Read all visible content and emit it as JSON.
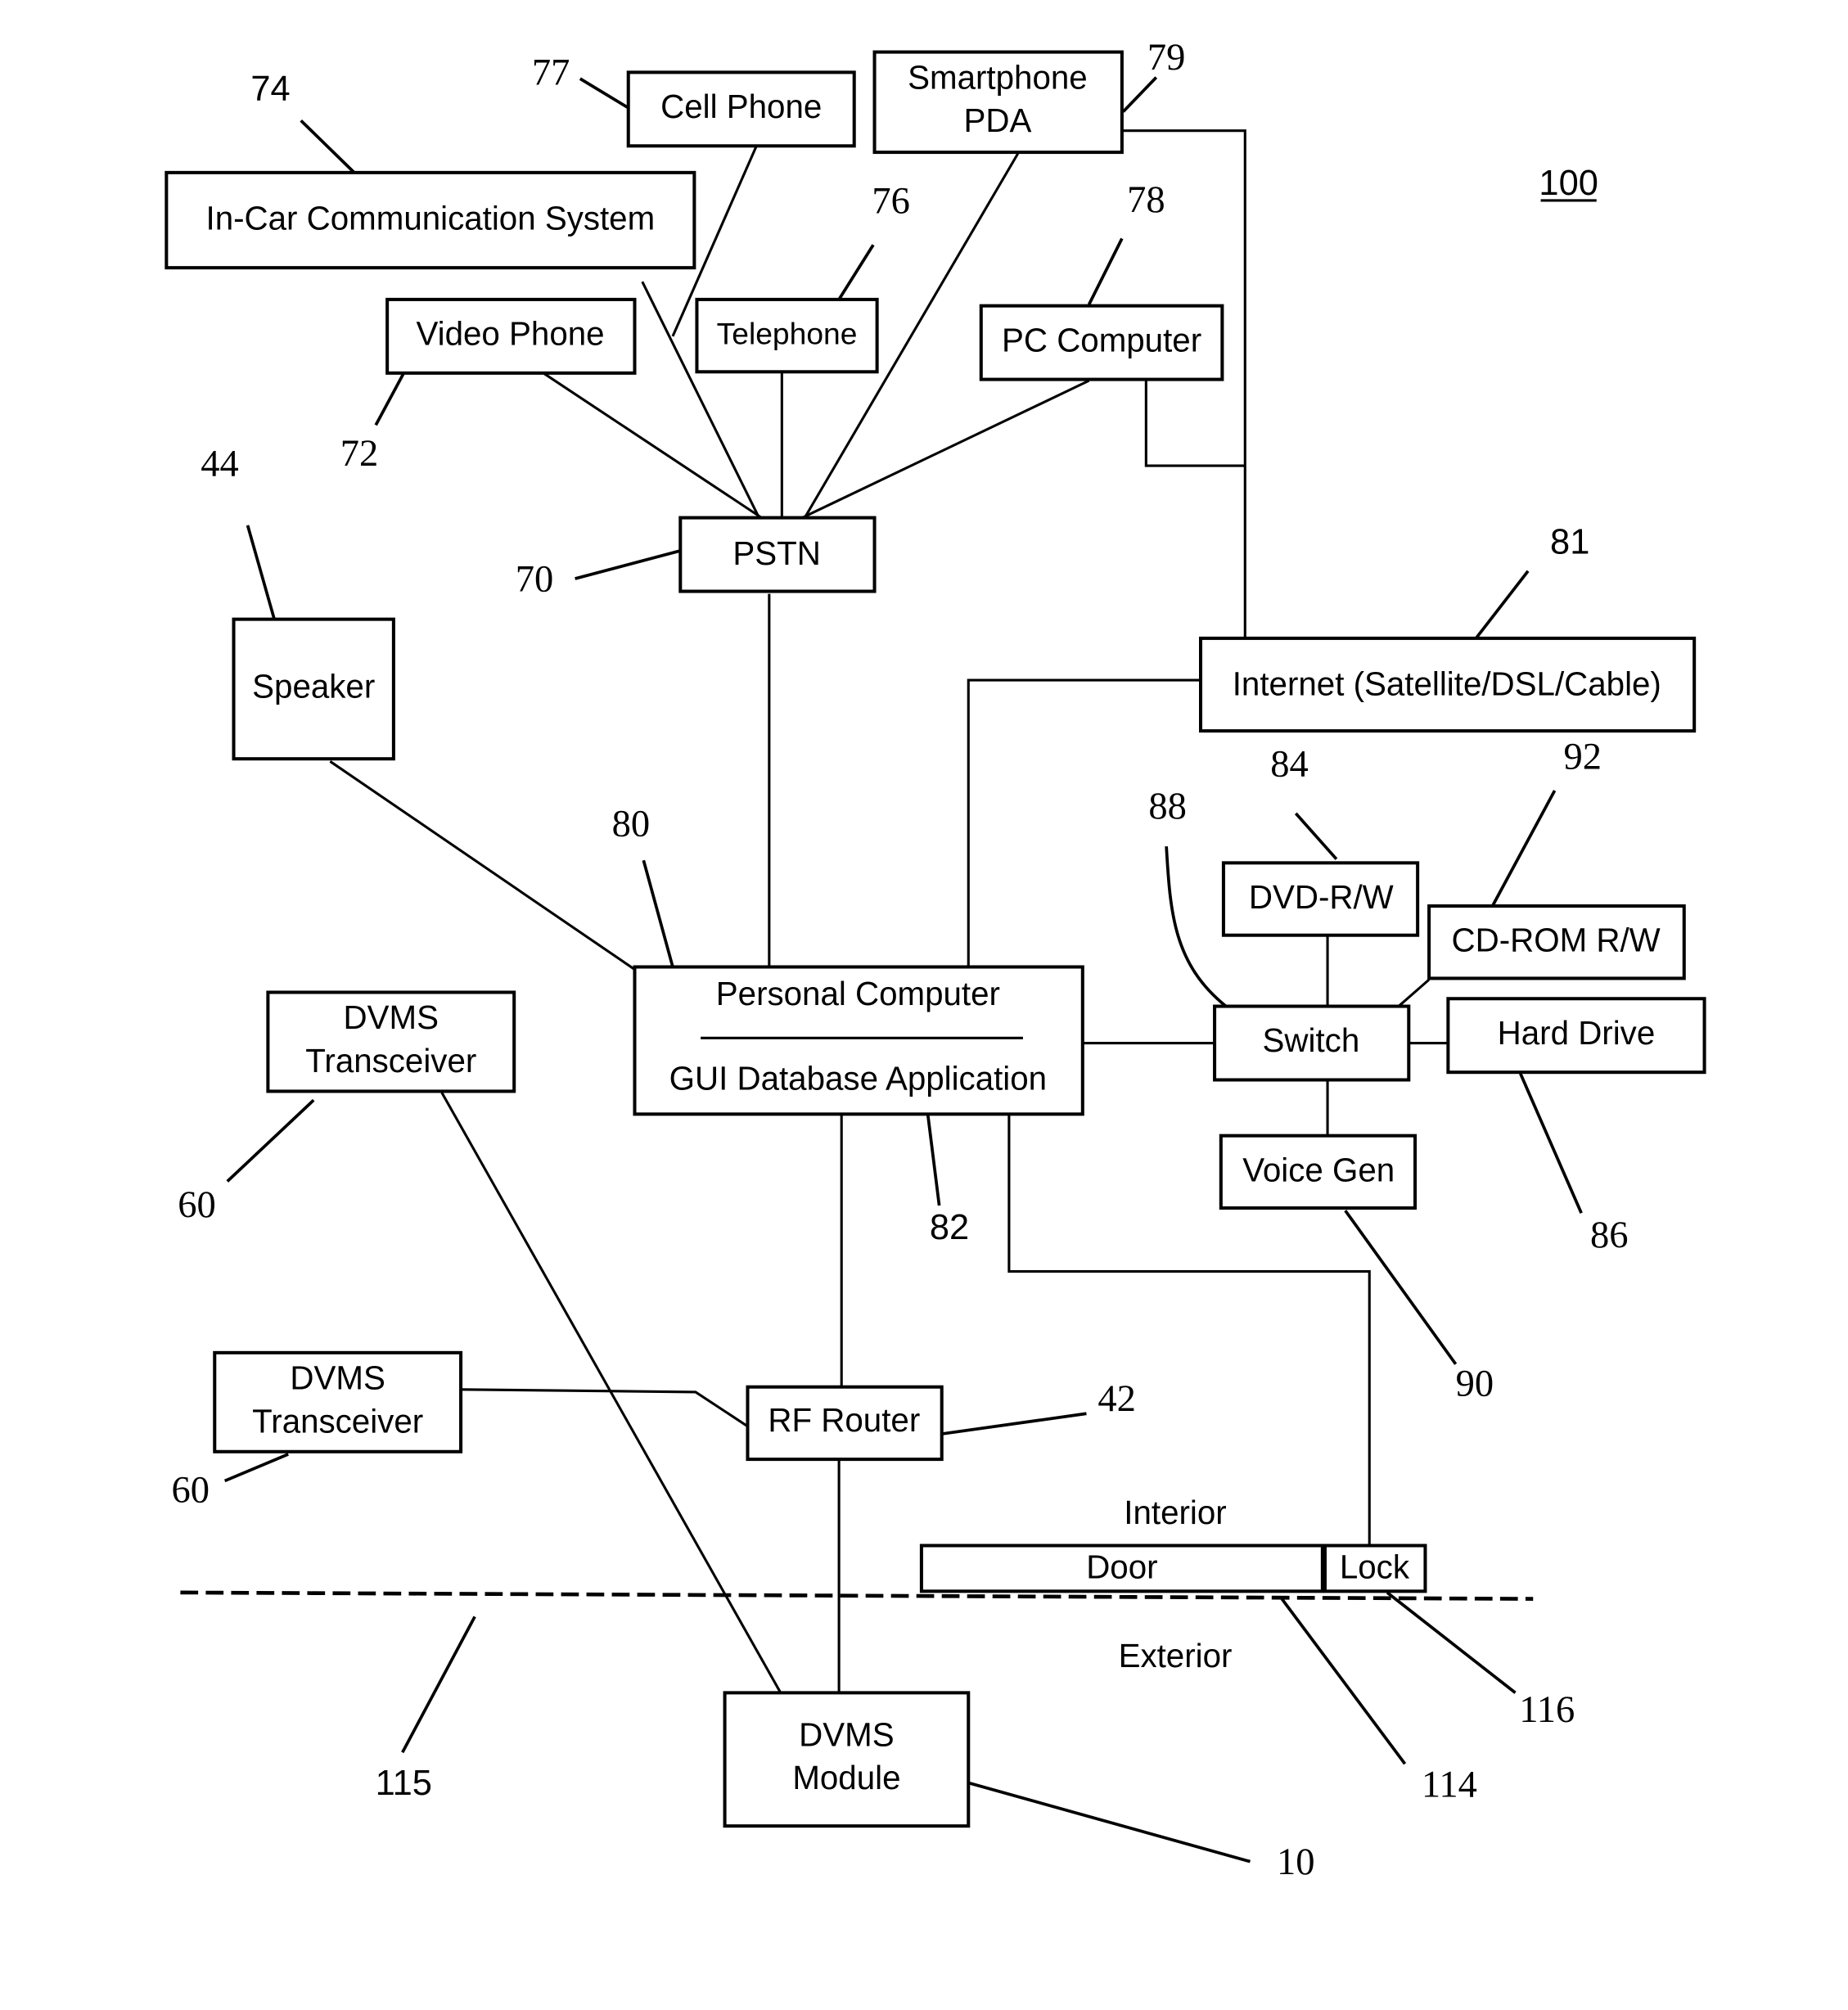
{
  "figure_number": "100",
  "nodes": {
    "in_car": {
      "label": "In-Car Communication System",
      "ref": "74"
    },
    "cell_phone": {
      "label": "Cell Phone",
      "ref": "77"
    },
    "smartphone": {
      "label_lines": [
        "Smartphone",
        "PDA"
      ],
      "ref": "79"
    },
    "video_phone": {
      "label": "Video Phone",
      "ref": "72"
    },
    "telephone": {
      "label": "Telephone",
      "ref": "76"
    },
    "pc_computer": {
      "label": "PC Computer",
      "ref": "78"
    },
    "pstn": {
      "label": "PSTN",
      "ref": "70"
    },
    "speaker": {
      "label": "Speaker",
      "ref": "44"
    },
    "internet": {
      "label": "Internet (Satellite/DSL/Cable)",
      "ref": "81"
    },
    "personal_computer": {
      "label_top": "Personal Computer",
      "label_bottom": "GUI Database Application",
      "ref": "80",
      "ref_app": "82"
    },
    "dvd": {
      "label": "DVD-R/W",
      "ref": "84"
    },
    "cdrom": {
      "label": "CD-ROM R/W",
      "ref": "92"
    },
    "switch": {
      "label": "Switch",
      "ref": "88"
    },
    "hard_drive": {
      "label": "Hard Drive",
      "ref": "86"
    },
    "voice_gen": {
      "label": "Voice Gen",
      "ref": "90"
    },
    "dvms_transceiver_1": {
      "label_lines": [
        "DVMS",
        "Transceiver"
      ],
      "ref": "60"
    },
    "dvms_transceiver_2": {
      "label_lines": [
        "DVMS",
        "Transceiver"
      ],
      "ref": "60"
    },
    "rf_router": {
      "label": "RF Router",
      "ref": "42"
    },
    "door": {
      "label": "Door",
      "ref": "114"
    },
    "lock": {
      "label": "Lock",
      "ref": "116"
    },
    "dvms_module": {
      "label_lines": [
        "DVMS",
        "Module"
      ],
      "ref": "10"
    }
  },
  "zones": {
    "interior": "Interior",
    "exterior": "Exterior",
    "boundary_ref": "115"
  }
}
